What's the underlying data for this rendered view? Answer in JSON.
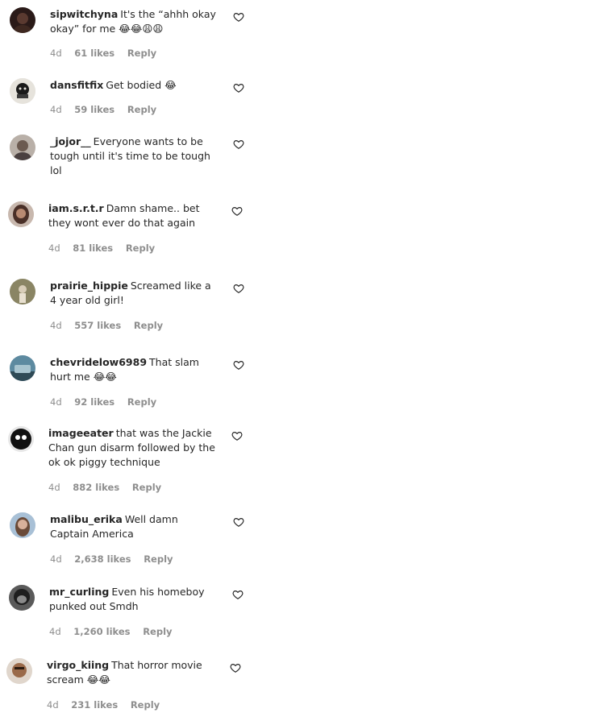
{
  "comments": [
    {
      "username": "sipwitchyna",
      "text": "It's the “ahhh okay okay” for me 😂😂😩😩",
      "time": "4d",
      "likes": "61 likes",
      "reply": "Reply",
      "avatar_color": "#3a2420"
    },
    {
      "username": "dansfitfix",
      "text": "Get bodied 😂",
      "time": "4d",
      "likes": "59 likes",
      "reply": "Reply",
      "avatar_color": "#d9d6cf"
    },
    {
      "username": "_jojor__",
      "text": "Everyone wants to be tough until it's time to be tough lol",
      "time": "",
      "likes": "",
      "reply": "",
      "avatar_color": "#9a8e86"
    },
    {
      "username": "iam.s.r.t.r",
      "text": "Damn shame.. bet they wont ever do that again",
      "time": "4d",
      "likes": "81 likes",
      "reply": "Reply",
      "avatar_color": "#6b5048"
    },
    {
      "username": "prairie_hippie",
      "text": "Screamed like a 4 year old girl!",
      "time": "4d",
      "likes": "557 likes",
      "reply": "Reply",
      "avatar_color": "#7f7a5e"
    },
    {
      "username": "chevridelow6989",
      "text": "That slam hurt me 😂😂",
      "time": "4d",
      "likes": "92 likes",
      "reply": "Reply",
      "avatar_color": "#4e7487"
    },
    {
      "username": "imageeater",
      "text": "that was the Jackie Chan gun disarm followed by the ok ok piggy technique",
      "time": "4d",
      "likes": "882 likes",
      "reply": "Reply",
      "avatar_color": "#1d1d1d"
    },
    {
      "username": "malibu_erika",
      "text": "Well damn Captain America",
      "time": "4d",
      "likes": "2,638 likes",
      "reply": "Reply",
      "avatar_color": "#9cb6cf"
    },
    {
      "username": "mr_curling",
      "text": "Even his homeboy punked out Smdh",
      "time": "4d",
      "likes": "1,260 likes",
      "reply": "Reply",
      "avatar_color": "#2c2c2c"
    },
    {
      "username": "virgo_kiing",
      "text": "That horror movie scream 😂😂",
      "time": "4d",
      "likes": "231 likes",
      "reply": "Reply",
      "avatar_color": "#b58a6a"
    }
  ],
  "icons": {
    "heart": "heart-outline-icon"
  },
  "colors": {
    "text": "#262626",
    "meta": "#8e8e8e"
  }
}
